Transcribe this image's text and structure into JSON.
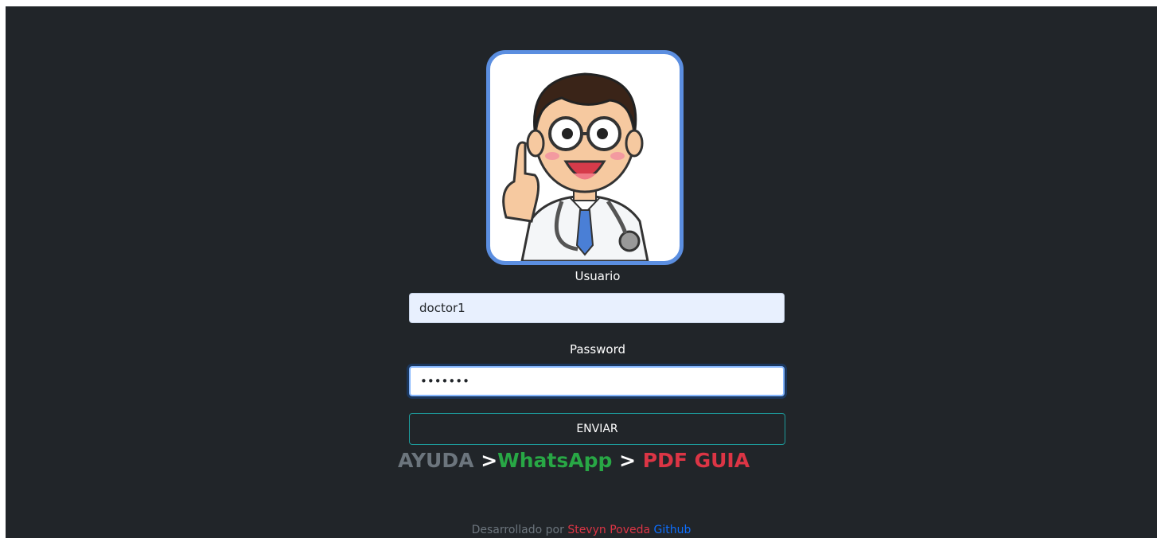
{
  "login": {
    "user_label": "Usuario",
    "user_value": "doctor1",
    "password_label": "Password",
    "password_value": "•••••••",
    "submit_label": "ENVIAR"
  },
  "help": {
    "ayuda": "AYUDA",
    "sep1": ">",
    "whatsapp": "WhatsApp",
    "sep2": ">",
    "pdf": "PDF GUIA"
  },
  "footer": {
    "prefix": "Desarrollado por",
    "author": "Stevyn Poveda",
    "github": "Github"
  },
  "colors": {
    "background": "#212529",
    "avatar_border": "#5b8ee0",
    "button_border": "#1d9a9a",
    "whatsapp": "#28a745",
    "pdf": "#dc3545",
    "muted": "#6c757d",
    "link": "#0d6efd"
  },
  "icons": {
    "avatar": "doctor-avatar-icon"
  }
}
